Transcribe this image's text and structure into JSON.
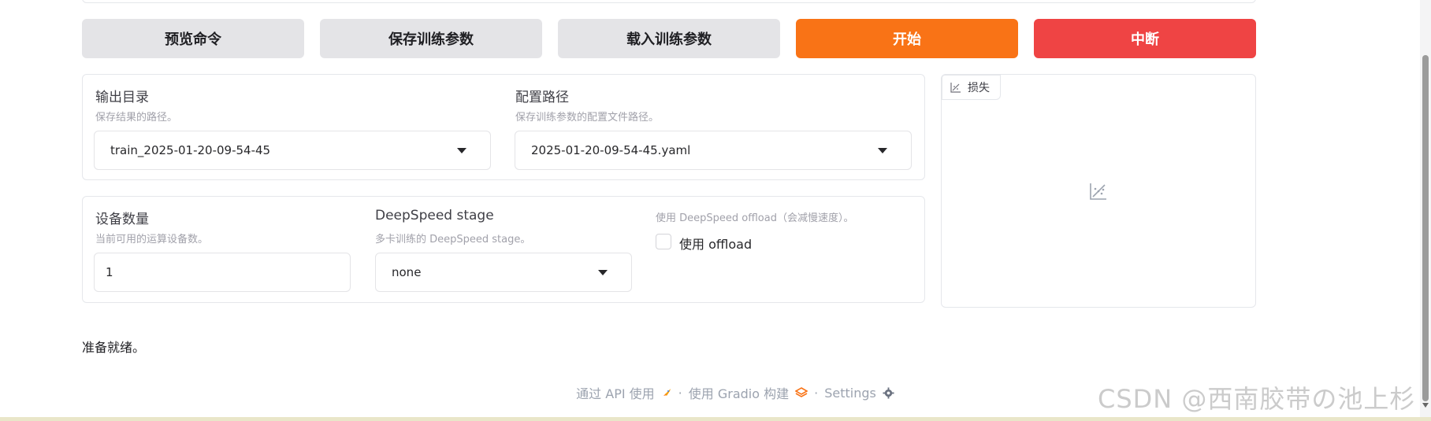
{
  "toolbar": {
    "preview_label": "预览命令",
    "save_args_label": "保存训练参数",
    "load_args_label": "载入训练参数",
    "start_label": "开始",
    "abort_label": "中断"
  },
  "output_dir": {
    "label": "输出目录",
    "info": "保存结果的路径。",
    "value": "train_2025-01-20-09-54-45"
  },
  "config_path": {
    "label": "配置路径",
    "info": "保存训练参数的配置文件路径。",
    "value": "2025-01-20-09-54-45.yaml"
  },
  "device_count": {
    "label": "设备数量",
    "info": "当前可用的运算设备数。",
    "value": "1"
  },
  "ds_stage": {
    "label": "DeepSpeed stage",
    "info": "多卡训练的 DeepSpeed stage。",
    "value": "none"
  },
  "ds_offload": {
    "info": "使用 DeepSpeed offload（会减慢速度）。",
    "label": "使用 offload",
    "checked": false
  },
  "loss_plot": {
    "tab_label": "损失"
  },
  "status_text": "准备就绪。",
  "footer": {
    "api_text": "通过 API 使用",
    "built_text": "使用 Gradio 构建",
    "settings_text": "Settings",
    "separator": "·"
  },
  "watermark": "CSDN @西南胶带の池上杉",
  "colors": {
    "primary": "#f97316",
    "stop": "#ef4444",
    "secondary": "#e4e4e7"
  }
}
